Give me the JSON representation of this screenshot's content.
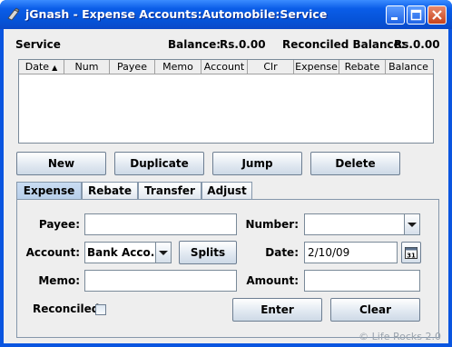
{
  "window": {
    "title": "jGnash - Expense Accounts:Automobile:Service"
  },
  "header": {
    "account_name": "Service",
    "balance_label": "Balance:",
    "balance_value": "Rs.0.00",
    "reconciled_label": "Reconciled Balance:",
    "reconciled_value": "Rs.0.00"
  },
  "register": {
    "columns": [
      "Date",
      "Num",
      "Payee",
      "Memo",
      "Account",
      "Clr",
      "Expense",
      "Rebate",
      "Balance"
    ],
    "sorted_column": "Date",
    "rows": []
  },
  "actions": {
    "new": "New",
    "duplicate": "Duplicate",
    "jump": "Jump",
    "delete": "Delete"
  },
  "tabs": [
    "Expense",
    "Rebate",
    "Transfer",
    "Adjust"
  ],
  "active_tab": "Expense",
  "form": {
    "payee_label": "Payee:",
    "payee_value": "",
    "number_label": "Number:",
    "number_value": "",
    "account_label": "Account:",
    "account_value": "Bank Acco...",
    "splits_label": "Splits",
    "date_label": "Date:",
    "date_value": "2/10/09",
    "calendar_icon_text": "31",
    "memo_label": "Memo:",
    "memo_value": "",
    "amount_label": "Amount:",
    "amount_value": "",
    "reconciled_label": "Reconciled",
    "reconciled_checked": false,
    "enter_label": "Enter",
    "clear_label": "Clear"
  },
  "watermark": "© Life Rocks 2.0",
  "icons": {
    "app": "jgnash-app-icon",
    "minimize": "minimize-icon",
    "maximize": "maximize-icon",
    "close": "close-icon",
    "combo_arrow": "chevron-down-icon",
    "calendar": "calendar-icon",
    "sort": "sort-ascending-icon"
  },
  "colors": {
    "titlebar": "#0a5de8",
    "client_bg": "#eeeeee",
    "close_button": "#c8431c"
  }
}
